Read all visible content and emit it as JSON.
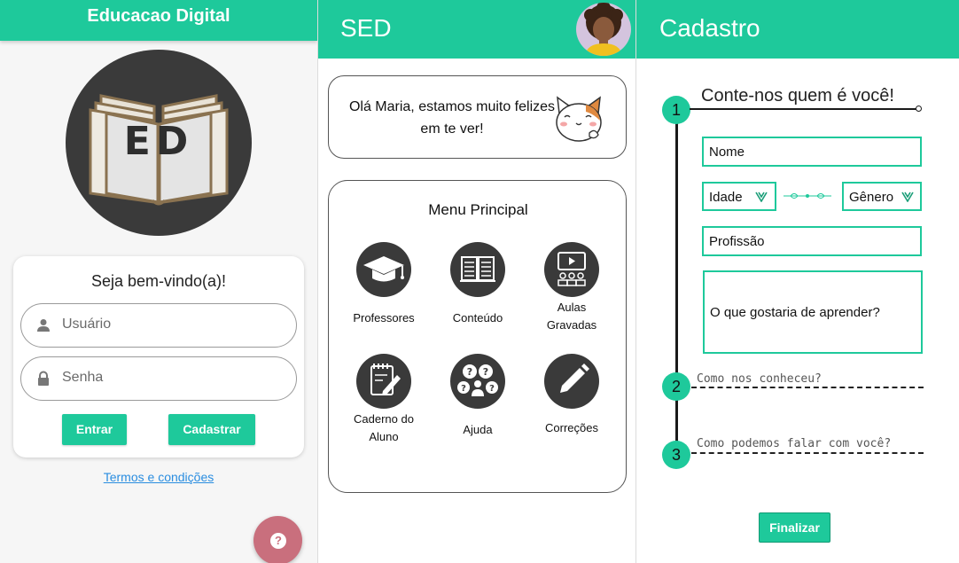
{
  "screen1": {
    "title": "Educacao Digital",
    "logo_text": "ED",
    "welcome": "Seja bem-vindo(a)!",
    "username_placeholder": "Usuário",
    "password_placeholder": "Senha",
    "login_label": "Entrar",
    "register_label": "Cadastrar",
    "terms_link": "Termos e condições",
    "help_icon_text": "?",
    "icons": {
      "user": "user-icon",
      "lock": "lock-icon",
      "help": "help-icon"
    },
    "colors": {
      "accent": "#1ec99b",
      "fab": "#c96f7d",
      "link": "#2a8de0"
    }
  },
  "screen2": {
    "title": "SED",
    "greeting": "Olá Maria, estamos muito felizes em te ver!",
    "menu_title": "Menu Principal",
    "menu_items": [
      {
        "label": "Professores",
        "icon": "graduation-cap-icon"
      },
      {
        "label": "Conteúdo",
        "icon": "book-icon"
      },
      {
        "label": "Aulas Gravadas",
        "icon": "video-class-icon"
      },
      {
        "label": "Caderno do Aluno",
        "icon": "notebook-icon"
      },
      {
        "label": "Ajuda",
        "icon": "help-people-icon"
      },
      {
        "label": "Correções",
        "icon": "pencil-icon"
      }
    ]
  },
  "screen3": {
    "title": "Cadastro",
    "steps": [
      "1",
      "2",
      "3"
    ],
    "step1_title": "Conte-nos quem é você!",
    "name_field": "Nome",
    "age_field": "Idade",
    "gender_field": "Gênero",
    "profession_field": "Profissão",
    "learn_field": "O que gostaria de aprender?",
    "step2_prompt": "Como nos conheceu?",
    "step3_prompt": "Como podemos falar com você?",
    "finish_label": "Finalizar"
  }
}
